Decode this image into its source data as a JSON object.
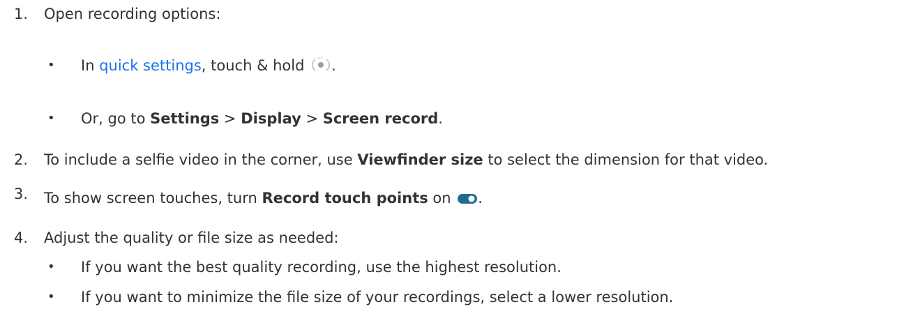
{
  "steps": [
    {
      "number": "1.",
      "text": "Open recording options:",
      "sub": [
        {
          "prefix": "In ",
          "link": "quick settings",
          "middle": ", touch & hold ",
          "icon": "screen-record-icon",
          "suffix": "."
        },
        {
          "prefix": "Or, go to ",
          "b1": "Settings",
          "sep1": " > ",
          "b2": "Display",
          "sep2": " > ",
          "b3": "Screen record",
          "suffix": "."
        }
      ]
    },
    {
      "number": "2.",
      "prefix": "To include a selfie video in the corner, use ",
      "bold": "Viewfinder size",
      "suffix": " to select the dimension for that video."
    },
    {
      "number": "3.",
      "prefix": "To show screen touches, turn ",
      "bold": "Record touch points",
      "middle": " on ",
      "icon": "toggle-on-icon",
      "suffix": "."
    },
    {
      "number": "4.",
      "text": "Adjust the quality or file size as needed:",
      "sub": [
        {
          "text": "If you want the best quality recording, use the highest resolution."
        },
        {
          "text": "If you want to minimize the file size of your recordings, select a lower resolution."
        }
      ]
    }
  ],
  "colors": {
    "text": "#333333",
    "link": "#1a73e8",
    "toggle_track": "#1f6c92",
    "toggle_knob": "#ffffff",
    "icon_ring": "#c7c7c7",
    "icon_dot": "#9e9e9e"
  }
}
